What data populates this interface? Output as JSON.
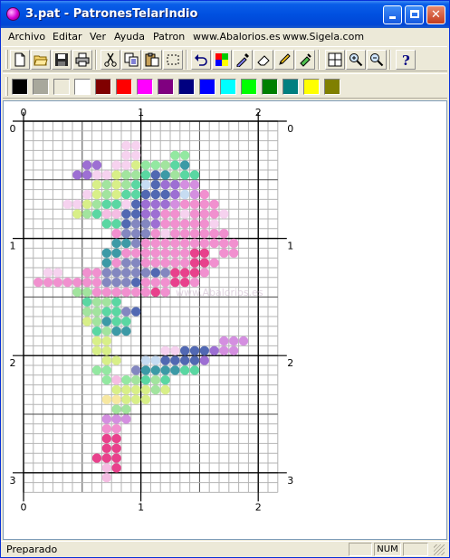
{
  "window": {
    "title": "3.pat - PatronesTelarIndio",
    "controls": {
      "minimize_icon": "minimize-icon",
      "maximize_icon": "maximize-icon",
      "close_icon": "close-icon"
    }
  },
  "menu": {
    "items": [
      "Archivo",
      "Editar",
      "Ver",
      "Ayuda",
      "Patron",
      "www.Abalorios.es",
      "www.Sigela.com"
    ]
  },
  "toolbar": {
    "buttons": [
      "new-file-icon",
      "open-folder-icon",
      "save-disk-icon",
      "print-icon",
      "cut-scissors-icon",
      "copy-icon",
      "paste-icon",
      "select-rectangle-icon",
      "undo-icon",
      "palette-icon",
      "eyedropper-icon",
      "eraser-icon",
      "pencil-icon",
      "fill-brush-icon",
      "grid-icon",
      "zoom-in-icon",
      "zoom-out-icon",
      "help-icon"
    ]
  },
  "palette": {
    "colors": [
      "#000000",
      "#a8a89c",
      "#ece9d8",
      "#ffffff",
      "#800000",
      "#ff0000",
      "#ff00ff",
      "#800080",
      "#000080",
      "#0000ff",
      "#00ffff",
      "#00ff00",
      "#008000",
      "#008080",
      "#ffff00",
      "#808000"
    ]
  },
  "canvas": {
    "ruler_labels": [
      "0",
      "1",
      "2",
      "3"
    ],
    "watermark": "www.Abalorios.es",
    "bead_colors": {
      "a": "#f5bde3",
      "b": "#f190cf",
      "c": "#e8418c",
      "d": "#c6dcf2",
      "e": "#d8ef88",
      "f": "#a2e49e",
      "g": "#5ad7a2",
      "h": "#3c9aa6",
      "i": "#8387c0",
      "j": "#5168b2",
      "k": "#9d6fd3",
      "l": "#d48fe0",
      "m": "#f6d2ef",
      "n": "#d7f08d",
      "o": "#93e8a1",
      "p": "#f7e8a1"
    },
    "pattern": [
      "..........................",
      "..........................",
      "..........mm..............",
      "..........mm...oo.........",
      "......kk.mmeoofgh.........",
      ".....kkmmeffgjhfgg........",
      ".......efefgdjkkll........",
      "......mefeggjjjkdlb.......",
      "....mmefggmjkkklbbbb......",
      ".....efgaajjkkbbmbbbm.....",
      "........ggjiikbbbbbm......",
      ".........biiibmbbbbbb.....",
      ".........hhibbbbbbbbbb....",
      "........hhbbbbbbbcc.bb....",
      "........hbiibbbbbccb......",
      "..mm..bbiiiiijicccb.......",
      ".bbbbbbbiiijbbbccb........",
      ".....ffbbbbbbcb...........",
      "......gffg................",
      "......ffggij..............",
      "......efhgg...............",
      ".......gfhh...............",
      ".......ee...........lll...",
      ".......ee.....mmjjjkll....",
      "........ee..ddjjjjk.......",
      ".......oo..ihhhhgg........",
      "........oaofgfg...........",
      ".........eeeefe...........",
      "........ppeee.............",
      ".........ff...............",
      "........lll...............",
      "........bb................",
      "........cc................",
      "........cc................",
      ".......ccc................",
      "........ac................",
      "........a.................",
      ".........................."
    ]
  },
  "status": {
    "text": "Preparado",
    "num": "NUM"
  }
}
